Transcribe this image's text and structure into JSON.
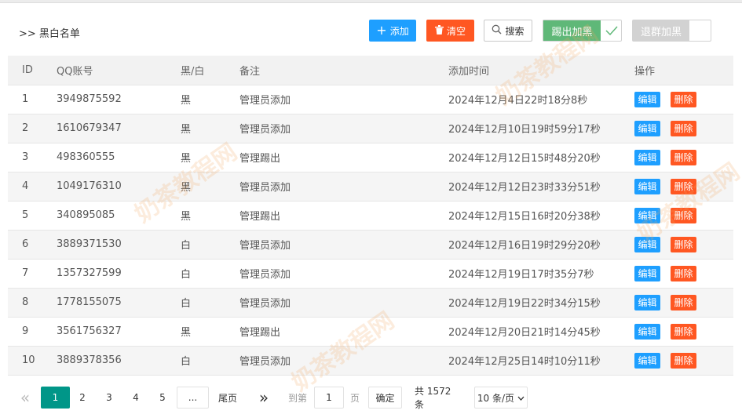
{
  "header": {
    "breadcrumb": ">> 黑白名单",
    "add_label": "添加",
    "clear_label": "清空",
    "search_label": "搜索",
    "kick_switch_label": "踢出加黑",
    "exit_switch_label": "退群加黑"
  },
  "table": {
    "columns": [
      "ID",
      "QQ账号",
      "黑/白",
      "备注",
      "添加时间",
      "操作"
    ],
    "edit_label": "编辑",
    "delete_label": "删除",
    "rows": [
      {
        "id": "1",
        "qq": "3949875592",
        "bw": "黑",
        "note": "管理员添加",
        "time": "2024年12月4日22时18分8秒"
      },
      {
        "id": "2",
        "qq": "1610679347",
        "bw": "黑",
        "note": "管理员添加",
        "time": "2024年12月10日19时59分17秒"
      },
      {
        "id": "3",
        "qq": "498360555",
        "bw": "黑",
        "note": "管理踢出",
        "time": "2024年12月12日15时48分20秒"
      },
      {
        "id": "4",
        "qq": "1049176310",
        "bw": "黑",
        "note": "管理员添加",
        "time": "2024年12月12日23时33分51秒"
      },
      {
        "id": "5",
        "qq": "340895085",
        "bw": "黑",
        "note": "管理踢出",
        "time": "2024年12月15日16时20分38秒"
      },
      {
        "id": "6",
        "qq": "3889371530",
        "bw": "白",
        "note": "管理员添加",
        "time": "2024年12月16日19时29分20秒"
      },
      {
        "id": "7",
        "qq": "1357327599",
        "bw": "白",
        "note": "管理员添加",
        "time": "2024年12月19日17时35分7秒"
      },
      {
        "id": "8",
        "qq": "1778155075",
        "bw": "白",
        "note": "管理员添加",
        "time": "2024年12月19日22时34分15秒"
      },
      {
        "id": "9",
        "qq": "3561756327",
        "bw": "黑",
        "note": "管理踢出",
        "time": "2024年12月20日21时14分45秒"
      },
      {
        "id": "10",
        "qq": "3889378356",
        "bw": "白",
        "note": "管理员添加",
        "time": "2024年12月25日14时10分11秒"
      }
    ]
  },
  "pager": {
    "first_symbol": "«",
    "pages": [
      "1",
      "2",
      "3",
      "4",
      "5"
    ],
    "ellipsis": "...",
    "last_label": "尾页",
    "next_symbol": "»",
    "goto_label": "到第",
    "goto_value": "1",
    "page_unit": "页",
    "confirm_label": "确定",
    "total_text": "共 1572 条",
    "per_page_label": "10 条/页"
  },
  "watermark": "奶茶教程网",
  "colors": {
    "primary": "#1e9fff",
    "danger": "#ff5722",
    "success": "#5fb878",
    "pager_active": "#009688"
  }
}
